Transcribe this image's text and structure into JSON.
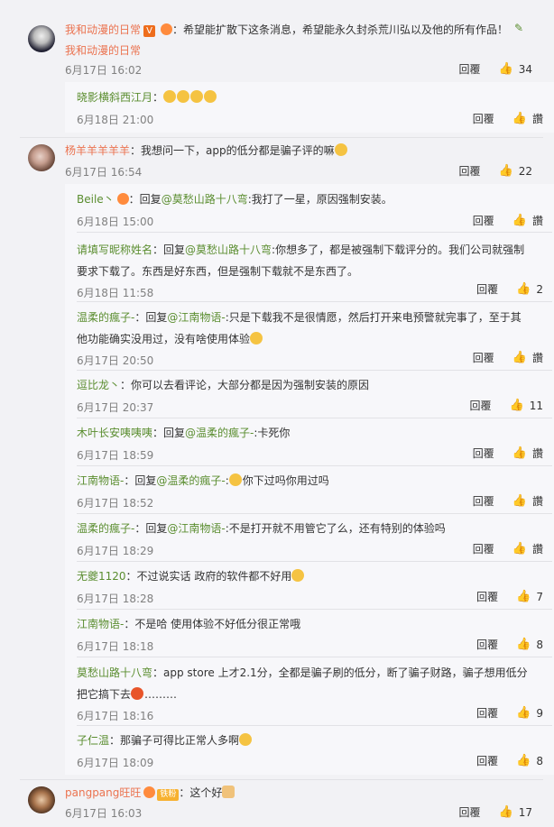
{
  "c1": {
    "name": "我和动漫的日常",
    "text": "：希望能扩散下这条消息，希望能永久封杀荒川弘以及他的所有作品！",
    "sig": "我和动漫的日常",
    "date": "6月17日 16:02",
    "reply": "回覆",
    "likes": "34",
    "replies": [
      {
        "name": "晓影横斜西江月",
        "text": "：",
        "date": "6月18日 21:00",
        "reply": "回覆",
        "likes": "讚"
      }
    ]
  },
  "c2": {
    "name": "杨羊羊羊羊羊",
    "text": "：我想问一下，app的低分都是骗子评的嘛",
    "date": "6月17日 16:54",
    "reply": "回覆",
    "likes": "22",
    "replies": [
      {
        "name": "Beile丶",
        "text": "：回复",
        "mention": "@莫愁山路十八弯",
        "rest": ":我打了一星，原因强制安装。",
        "date": "6月18日 15:00",
        "reply": "回覆",
        "likes": "讚"
      },
      {
        "name": "请填写昵称姓名",
        "text": "：回复",
        "mention": "@莫愁山路十八弯",
        "rest": ":你想多了，都是被强制下载评分的。我们公司就强制",
        "line2": "要求下载了。东西是好东西，但是强制下载就不是东西了。",
        "date": "6月18日 11:58",
        "reply": "回覆",
        "likes": "2"
      },
      {
        "name": "温柔的瘋子-",
        "text": "：回复",
        "mention": "@江南物语-",
        "rest": ":只是下载我不是很情愿，然后打开来电预警就完事了，至于其",
        "line2": "他功能确实没用过，没有啥使用体验",
        "date": "6月17日 20:50",
        "reply": "回覆",
        "likes": "讚"
      },
      {
        "name": "逗比龙丶",
        "text": "：你可以去看评论，大部分都是因为强制安装的原因",
        "date": "6月17日 20:37",
        "reply": "回覆",
        "likes": "11"
      },
      {
        "name": "木叶长安咦咦咦",
        "text": "：回复",
        "mention": "@温柔的瘋子-",
        "rest": ":卡死你",
        "date": "6月17日 18:59",
        "reply": "回覆",
        "likes": "讚"
      },
      {
        "name": "江南物语-",
        "text": "：回复",
        "mention": "@温柔的瘋子-",
        "rest": ":",
        "rest2": "你下过吗你用过吗",
        "date": "6月17日 18:52",
        "reply": "回覆",
        "likes": "讚"
      },
      {
        "name": "温柔的瘋子-",
        "text": "：回复",
        "mention": "@江南物语-",
        "rest": ":不是打开就不用管它了么，还有特别的体验吗",
        "date": "6月17日 18:29",
        "reply": "回覆",
        "likes": "讚"
      },
      {
        "name": "无夔1120",
        "text": "：不过说实话 政府的软件都不好用",
        "date": "6月17日 18:28",
        "reply": "回覆",
        "likes": "7"
      },
      {
        "name": "江南物语-",
        "text": "：不是哈 使用体验不好低分很正常哦",
        "date": "6月17日 18:18",
        "reply": "回覆",
        "likes": "8"
      },
      {
        "name": "莫愁山路十八弯",
        "text": "：app store 上才2.1分，全都是骗子刷的低分，断了骗子财路，骗子想用低分",
        "line2a": "把它搞下去",
        "line2b": "………",
        "date": "6月17日 18:16",
        "reply": "回覆",
        "likes": "9"
      },
      {
        "name": "子仁温",
        "text": "：那骗子可得比正常人多啊",
        "date": "6月17日 18:09",
        "reply": "回覆",
        "likes": "8"
      }
    ]
  },
  "c3": {
    "name": "pangpang旺旺",
    "badge": "铁粉",
    "text": "：这个好",
    "date": "6月17日 16:03",
    "reply": "回覆",
    "likes": "17"
  }
}
